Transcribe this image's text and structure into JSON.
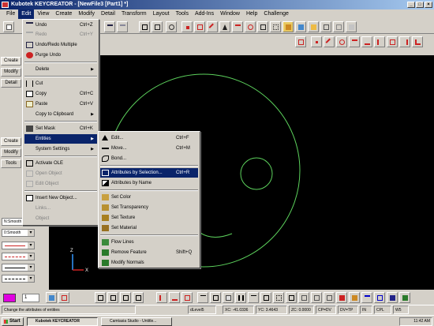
{
  "window": {
    "title": "Kubotek KEYCREATOR - [NewFile3 [Part1] *]"
  },
  "menubar": [
    "File",
    "Edit",
    "View",
    "Create",
    "Modify",
    "Detail",
    "Transform",
    "Layout",
    "Tools",
    "Add-Ins",
    "Window",
    "Help",
    "Challenge"
  ],
  "edit_menu": {
    "items": [
      {
        "label": "Undo",
        "shortcut": "Ctrl+Z",
        "enabled": true,
        "icon": "undo-icon"
      },
      {
        "label": "Redo",
        "shortcut": "Ctrl+Y",
        "enabled": false,
        "icon": "redo-icon"
      },
      {
        "label": "Undo/Redo Multiple",
        "shortcut": "",
        "enabled": true,
        "icon": "undo-redo-multiple-icon"
      },
      {
        "label": "Purge Undo",
        "shortcut": "",
        "enabled": true,
        "icon": "purge-undo-icon"
      },
      {
        "label": "Delete",
        "shortcut": "",
        "enabled": true,
        "submenu": true
      },
      {
        "label": "Cut",
        "shortcut": "",
        "enabled": true,
        "icon": "cut-icon"
      },
      {
        "label": "Copy",
        "shortcut": "Ctrl+C",
        "enabled": true,
        "icon": "copy-icon"
      },
      {
        "label": "Paste",
        "shortcut": "Ctrl+V",
        "enabled": true,
        "icon": "paste-icon"
      },
      {
        "label": "Copy to Clipboard",
        "shortcut": "",
        "enabled": true,
        "submenu": true
      },
      {
        "label": "Set Mask",
        "shortcut": "Ctrl+K",
        "enabled": true,
        "icon": "set-mask-icon"
      },
      {
        "label": "Entities",
        "shortcut": "",
        "enabled": true,
        "submenu": true,
        "highlighted": true
      },
      {
        "label": "System Settings",
        "shortcut": "",
        "enabled": true,
        "submenu": true
      },
      {
        "label": "Activate OLE",
        "shortcut": "",
        "enabled": true,
        "icon": "activate-ole-icon"
      },
      {
        "label": "Open Object",
        "shortcut": "",
        "enabled": false,
        "icon": "open-object-icon"
      },
      {
        "label": "Edit Object",
        "shortcut": "",
        "enabled": false,
        "icon": "edit-object-icon"
      },
      {
        "label": "Insert New Object...",
        "shortcut": "",
        "enabled": true,
        "icon": "insert-object-icon"
      },
      {
        "label": "Links...",
        "shortcut": "",
        "enabled": false
      },
      {
        "label": "Object",
        "shortcut": "",
        "enabled": false
      }
    ]
  },
  "entities_menu": {
    "items": [
      {
        "label": "Edit...",
        "shortcut": "Ctrl+F",
        "icon": "edit-entity-icon"
      },
      {
        "label": "Move...",
        "shortcut": "Ctrl+M",
        "icon": "move-icon"
      },
      {
        "label": "Bond...",
        "shortcut": "",
        "icon": "bond-icon"
      },
      {
        "label": "Attributes by Selection...",
        "shortcut": "Ctrl+R",
        "icon": "attributes-selection-icon",
        "highlighted": true
      },
      {
        "label": "Attributes by Name",
        "shortcut": "",
        "icon": "attributes-name-icon"
      },
      {
        "label": "Set Color",
        "shortcut": "",
        "icon": "set-color-icon"
      },
      {
        "label": "Set Transparency",
        "shortcut": "",
        "icon": "set-transparency-icon"
      },
      {
        "label": "Set Texture",
        "shortcut": "",
        "icon": "set-texture-icon"
      },
      {
        "label": "Set Material",
        "shortcut": "",
        "icon": "set-material-icon"
      },
      {
        "label": "Flow Lines",
        "shortcut": "",
        "icon": "flow-lines-icon"
      },
      {
        "label": "Remove Feature",
        "shortcut": "Shift+Q",
        "icon": "remove-feature-icon"
      },
      {
        "label": "Modify Normals",
        "shortcut": "",
        "icon": "modify-normals-icon"
      }
    ]
  },
  "left_panel": {
    "tabs1": [
      "Create",
      "Modify",
      "Detail"
    ],
    "tabs2": [
      "Create",
      "Modify",
      "Tools"
    ],
    "combos": [
      "N:Smooth",
      "0:Smooth"
    ]
  },
  "bottom_toolbar": {
    "color_swatch": "#e000e0",
    "layer_value": "1"
  },
  "status": {
    "message": "Change the attributes of entities",
    "layer": "dLevel5",
    "xc": "XC: -41.0336",
    "yc": "YC: 3.4643",
    "zc": "ZC: 0.0000",
    "cplane": "CP=DV",
    "dv": "DV=TP",
    "cplane2": "IN",
    "ml": "CPL",
    "wd": "W5"
  },
  "taskbar": {
    "start": "Start",
    "tasks": [
      "Kubotek KEYCREATOR",
      "Camtasia Studio - Untitle..."
    ],
    "time": "11:42 AM"
  },
  "colors": {
    "title_start": "#0a246a",
    "title_end": "#a6caf0",
    "canvas_bg": "#000000",
    "geometry": "#5cd15c",
    "accent_red": "#cc2222"
  }
}
